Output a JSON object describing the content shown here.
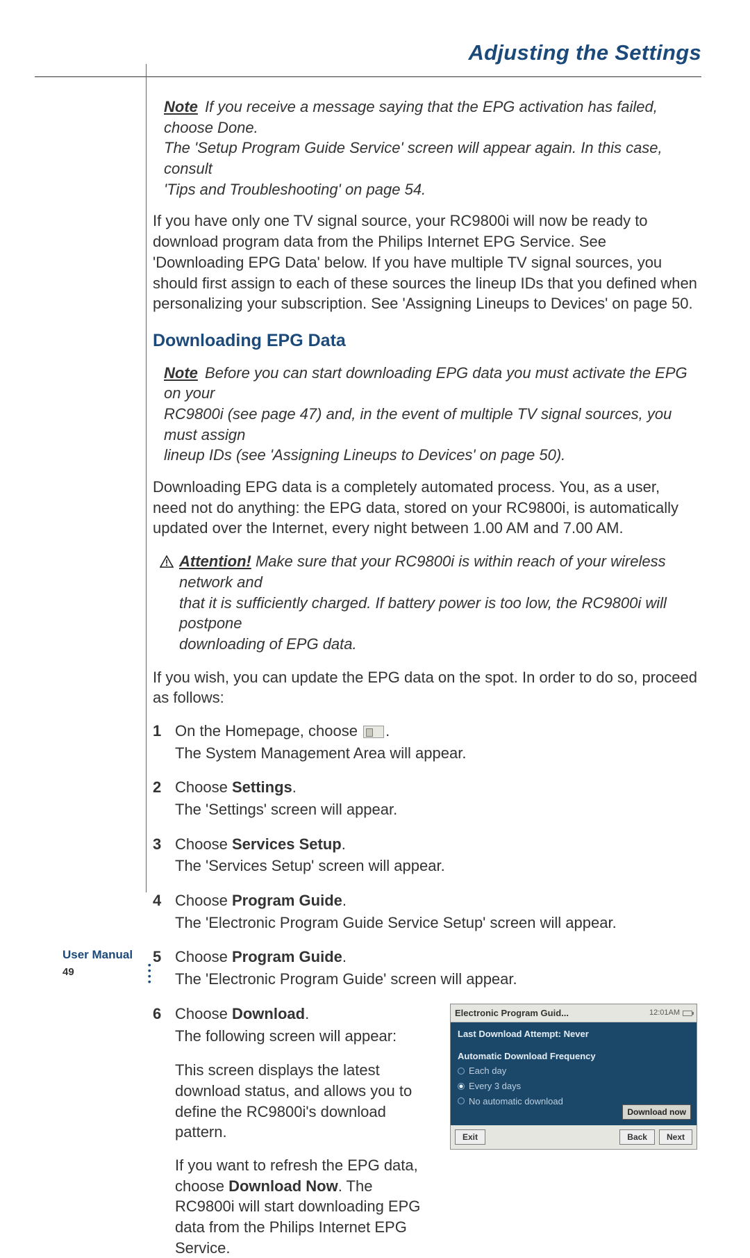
{
  "header": {
    "title": "Adjusting the Settings"
  },
  "intro_note": {
    "label": "Note",
    "l1": "If you receive a message saying that the EPG activation has failed, choose Done.",
    "l2": "The 'Setup Program Guide Service' screen will appear again. In this case, consult",
    "l3": "'Tips and Troubleshooting' on page 54."
  },
  "para1": "If you have only one TV signal source, your RC9800i will now be ready to download program data from the Philips Internet EPG Service. See 'Downloading EPG Data' below. If you have multiple TV signal sources, you should first assign to each of these sources the lineup IDs that you defined when personalizing your subscription. See 'Assigning Lineups to Devices' on page 50.",
  "h2": "Downloading EPG Data",
  "note2": {
    "label": "Note",
    "l1": "Before you can start downloading EPG data you must activate the EPG on your",
    "l2": "RC9800i (see page 47) and, in the event of multiple TV signal sources, you must assign",
    "l3": "lineup IDs (see 'Assigning Lineups to Devices' on page 50)."
  },
  "para2": "Downloading EPG data is a completely automated process. You, as a user, need not do anything: the EPG data, stored on your RC9800i, is automatically updated over the Internet, every night between 1.00 AM and 7.00 AM.",
  "attention": {
    "label": "Attention!",
    "l1": "Make sure that your RC9800i is within reach of your wireless network and",
    "l2": "that it is sufficiently charged. If battery power is too low, the RC9800i will postpone",
    "l3": "downloading of EPG data."
  },
  "para3": "If you wish, you can update the EPG data on the spot. In order to do so, proceed as follows:",
  "steps": {
    "s1": {
      "head_a": "On the Homepage, choose ",
      "head_b": ".",
      "sub": "The System Management Area will appear."
    },
    "s2": {
      "head_a": "Choose ",
      "bold": "Settings",
      "head_b": ".",
      "sub": "The 'Settings' screen will appear."
    },
    "s3": {
      "head_a": "Choose ",
      "bold": "Services Setup",
      "head_b": ".",
      "sub": "The 'Services Setup' screen will appear."
    },
    "s4": {
      "head_a": "Choose ",
      "bold": "Program Guide",
      "head_b": ".",
      "sub": "The 'Electronic Program Guide Service Setup' screen will appear."
    },
    "s5": {
      "head_a": "Choose ",
      "bold": "Program Guide",
      "head_b": ".",
      "sub": "The 'Electronic Program Guide' screen will appear."
    },
    "s6": {
      "head_a": "Choose ",
      "bold": "Download",
      "head_b": ".",
      "sub": "The following screen will appear:",
      "p2": "This screen displays the latest download status, and allows you to define the RC9800i's download pattern.",
      "p3a": "If you want to refresh the EPG data, choose ",
      "p3bold": "Download Now",
      "p3b": ". The RC9800i will start downloading EPG data from the Philips Internet EPG Service."
    }
  },
  "screenshot": {
    "title": "Electronic Program Guid...",
    "clock": "12:01AM",
    "status": "Last Download Attempt: Never",
    "section": "Automatic Download Frequency",
    "opt1": "Each day",
    "opt2": "Every 3 days",
    "opt3": "No automatic download",
    "download_now": "Download now",
    "exit": "Exit",
    "back": "Back",
    "next": "Next"
  },
  "footer": {
    "label": "User Manual",
    "page": "49"
  }
}
